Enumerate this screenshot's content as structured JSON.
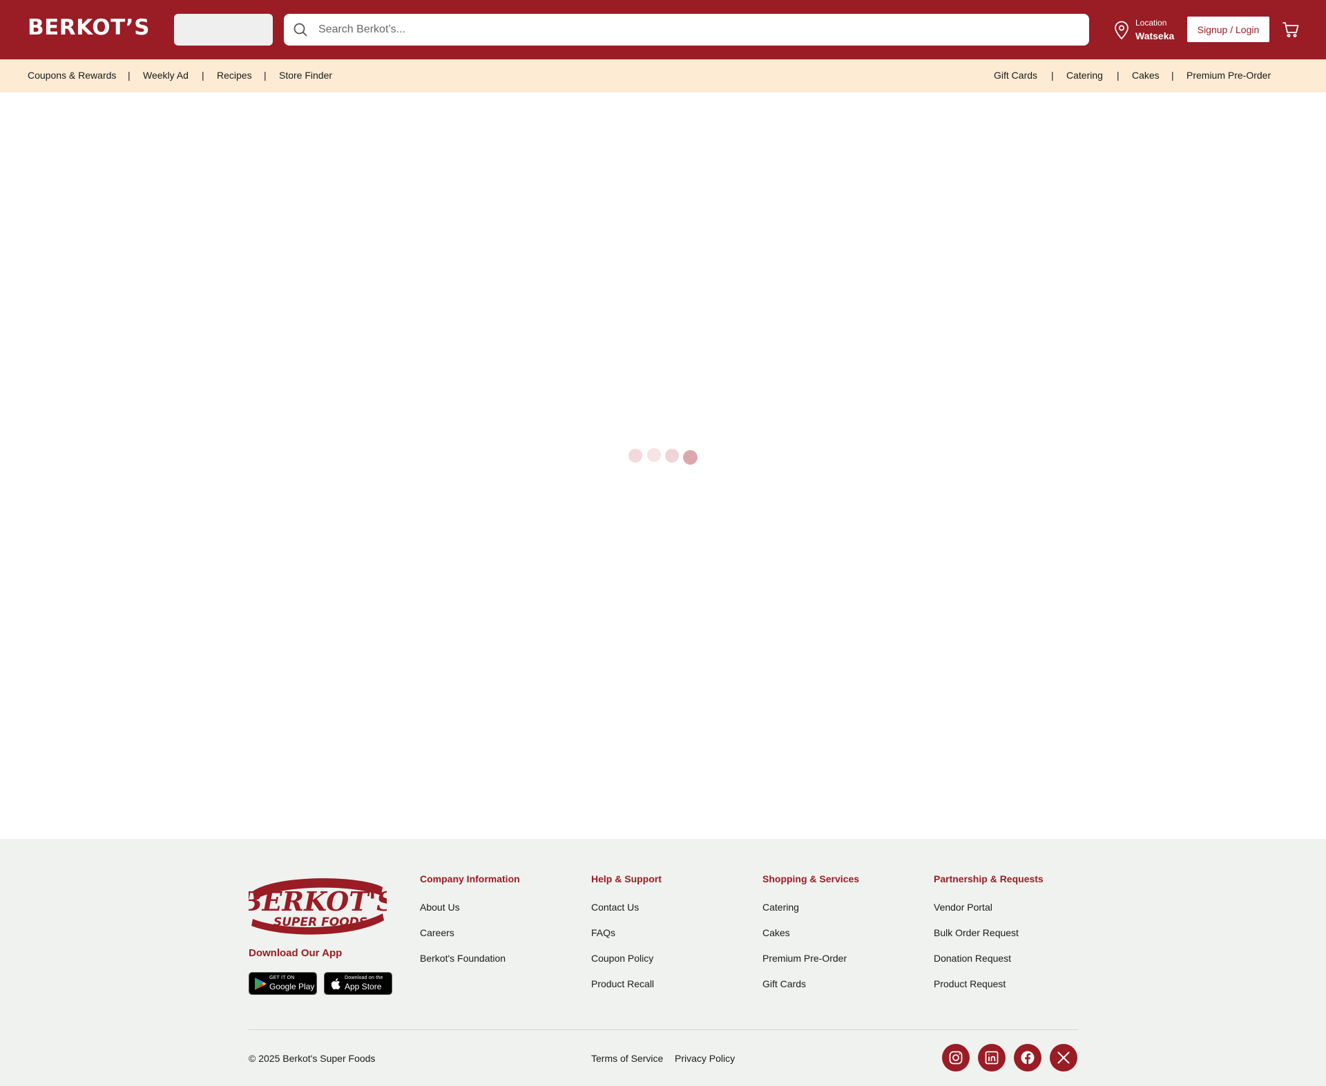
{
  "header": {
    "logo": "BERKOT’S",
    "search_placeholder": "Search Berkot’s...",
    "location_label": "Location",
    "location_value": "Watseka",
    "signup_label": "Signup / Login",
    "brand_color": "#9a1c25"
  },
  "subnav": {
    "left": [
      "Coupons & Rewards",
      "Weekly Ad",
      "Recipes",
      "Store Finder"
    ],
    "right": [
      "Gift Cards",
      "Catering",
      "Cakes",
      "Premium Pre-Order"
    ],
    "separator": "|",
    "background": "#fdebd3"
  },
  "footer": {
    "logo_line1": "BERKOT'S",
    "logo_line2": "SUPER FOODS",
    "download_title": "Download Our App",
    "google_play_small": "GET IT ON",
    "google_play_big": "Google Play",
    "app_store_small": "Download on the",
    "app_store_big": "App Store",
    "columns": [
      {
        "title": "Company Information",
        "links": [
          "About Us",
          "Careers",
          "Berkot's Foundation"
        ]
      },
      {
        "title": "Help & Support",
        "links": [
          "Contact Us",
          "FAQs",
          "Coupon Policy",
          "Product Recall"
        ]
      },
      {
        "title": "Shopping & Services",
        "links": [
          "Catering",
          "Cakes",
          "Premium Pre-Order",
          "Gift Cards"
        ]
      },
      {
        "title": "Partnership & Requests",
        "links": [
          "Vendor Portal",
          "Bulk Order Request",
          "Donation Request",
          "Product Request"
        ]
      }
    ],
    "copyright": "© 2025 Berkot's Super Foods",
    "legal": [
      "Terms of Service",
      "Privacy Policy"
    ],
    "social": [
      "instagram-icon",
      "linkedin-icon",
      "facebook-icon",
      "x-icon"
    ]
  }
}
